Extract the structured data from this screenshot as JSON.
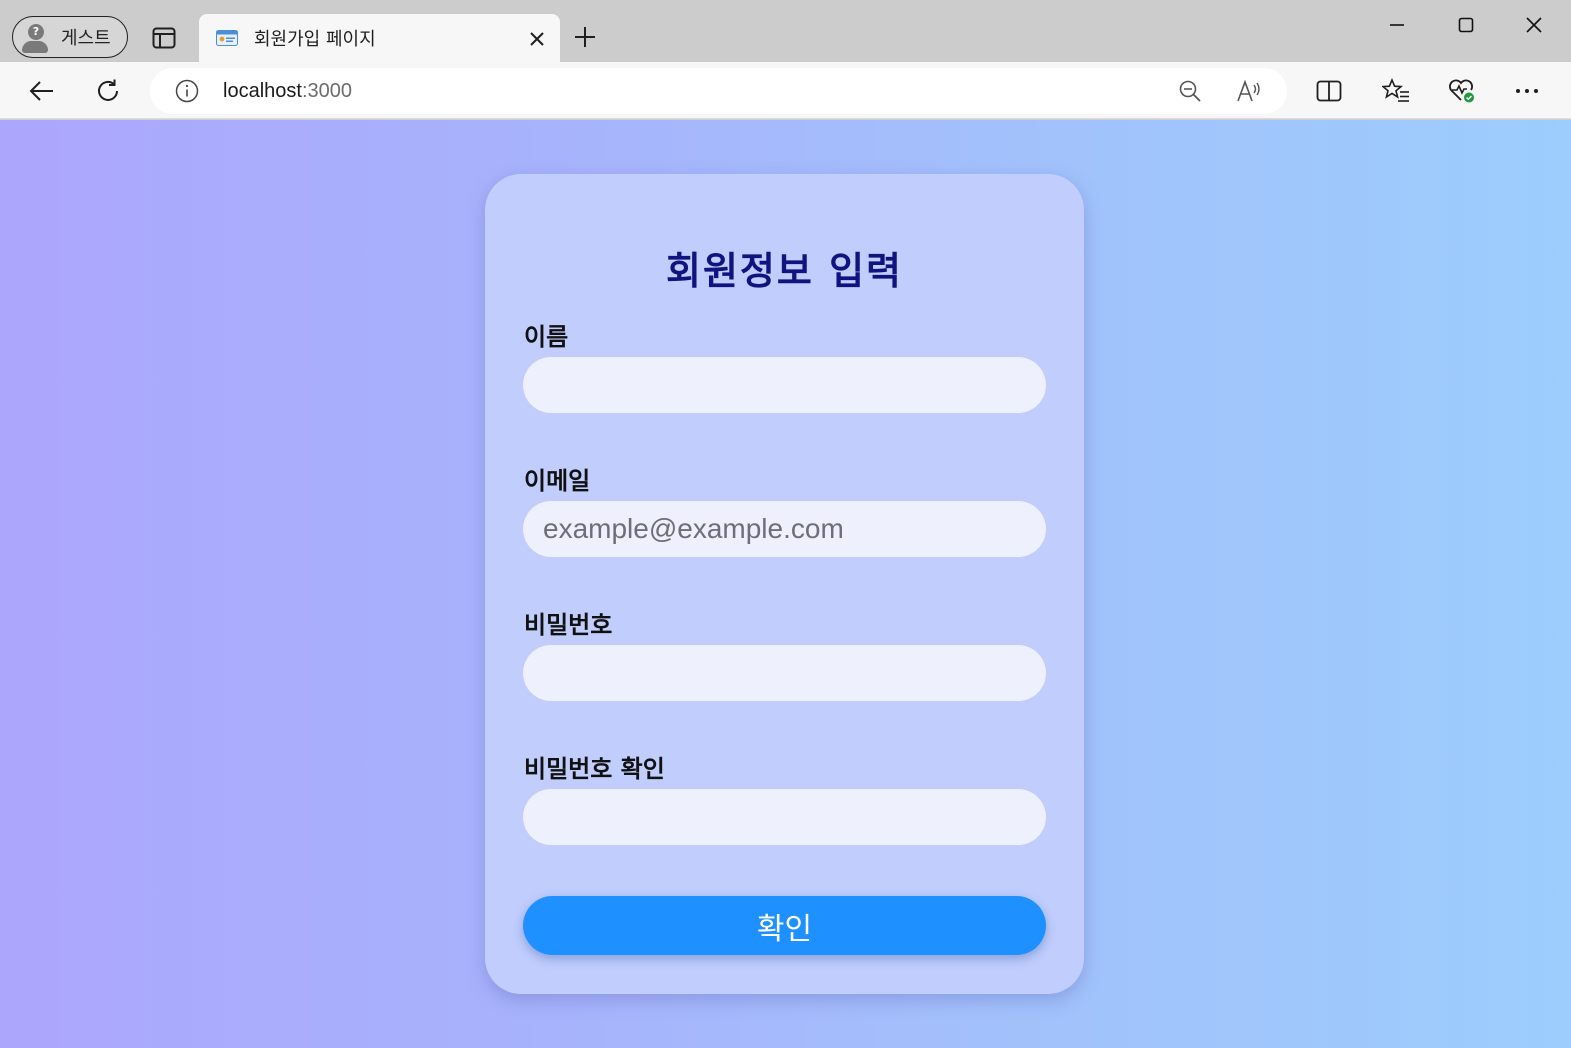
{
  "browser": {
    "profile_label": "게스트",
    "tab_title": "회원가입 페이지",
    "url_host": "localhost",
    "url_port": ":3000"
  },
  "form": {
    "title": "회원정보 입력",
    "fields": [
      {
        "label": "이름",
        "placeholder": "",
        "value": ""
      },
      {
        "label": "이메일",
        "placeholder": "example@example.com",
        "value": ""
      },
      {
        "label": "비밀번호",
        "placeholder": "",
        "value": ""
      },
      {
        "label": "비밀번호 확인",
        "placeholder": "",
        "value": ""
      }
    ],
    "submit_label": "확인"
  },
  "colors": {
    "title": "#10147e",
    "button": "#1e90ff",
    "card": "#c0cdfd"
  },
  "icons": {
    "profile": "guest-avatar-icon",
    "tabs": "tab-actions-icon",
    "favicon": "id-card-icon",
    "close": "close-icon",
    "new_tab": "plus-icon",
    "back": "back-arrow-icon",
    "refresh": "refresh-icon",
    "info": "info-icon",
    "zoom": "zoom-out-icon",
    "read_aloud": "read-aloud-icon",
    "split": "split-screen-icon",
    "favorites": "favorites-icon",
    "health": "browser-essentials-icon",
    "more": "more-icon"
  }
}
